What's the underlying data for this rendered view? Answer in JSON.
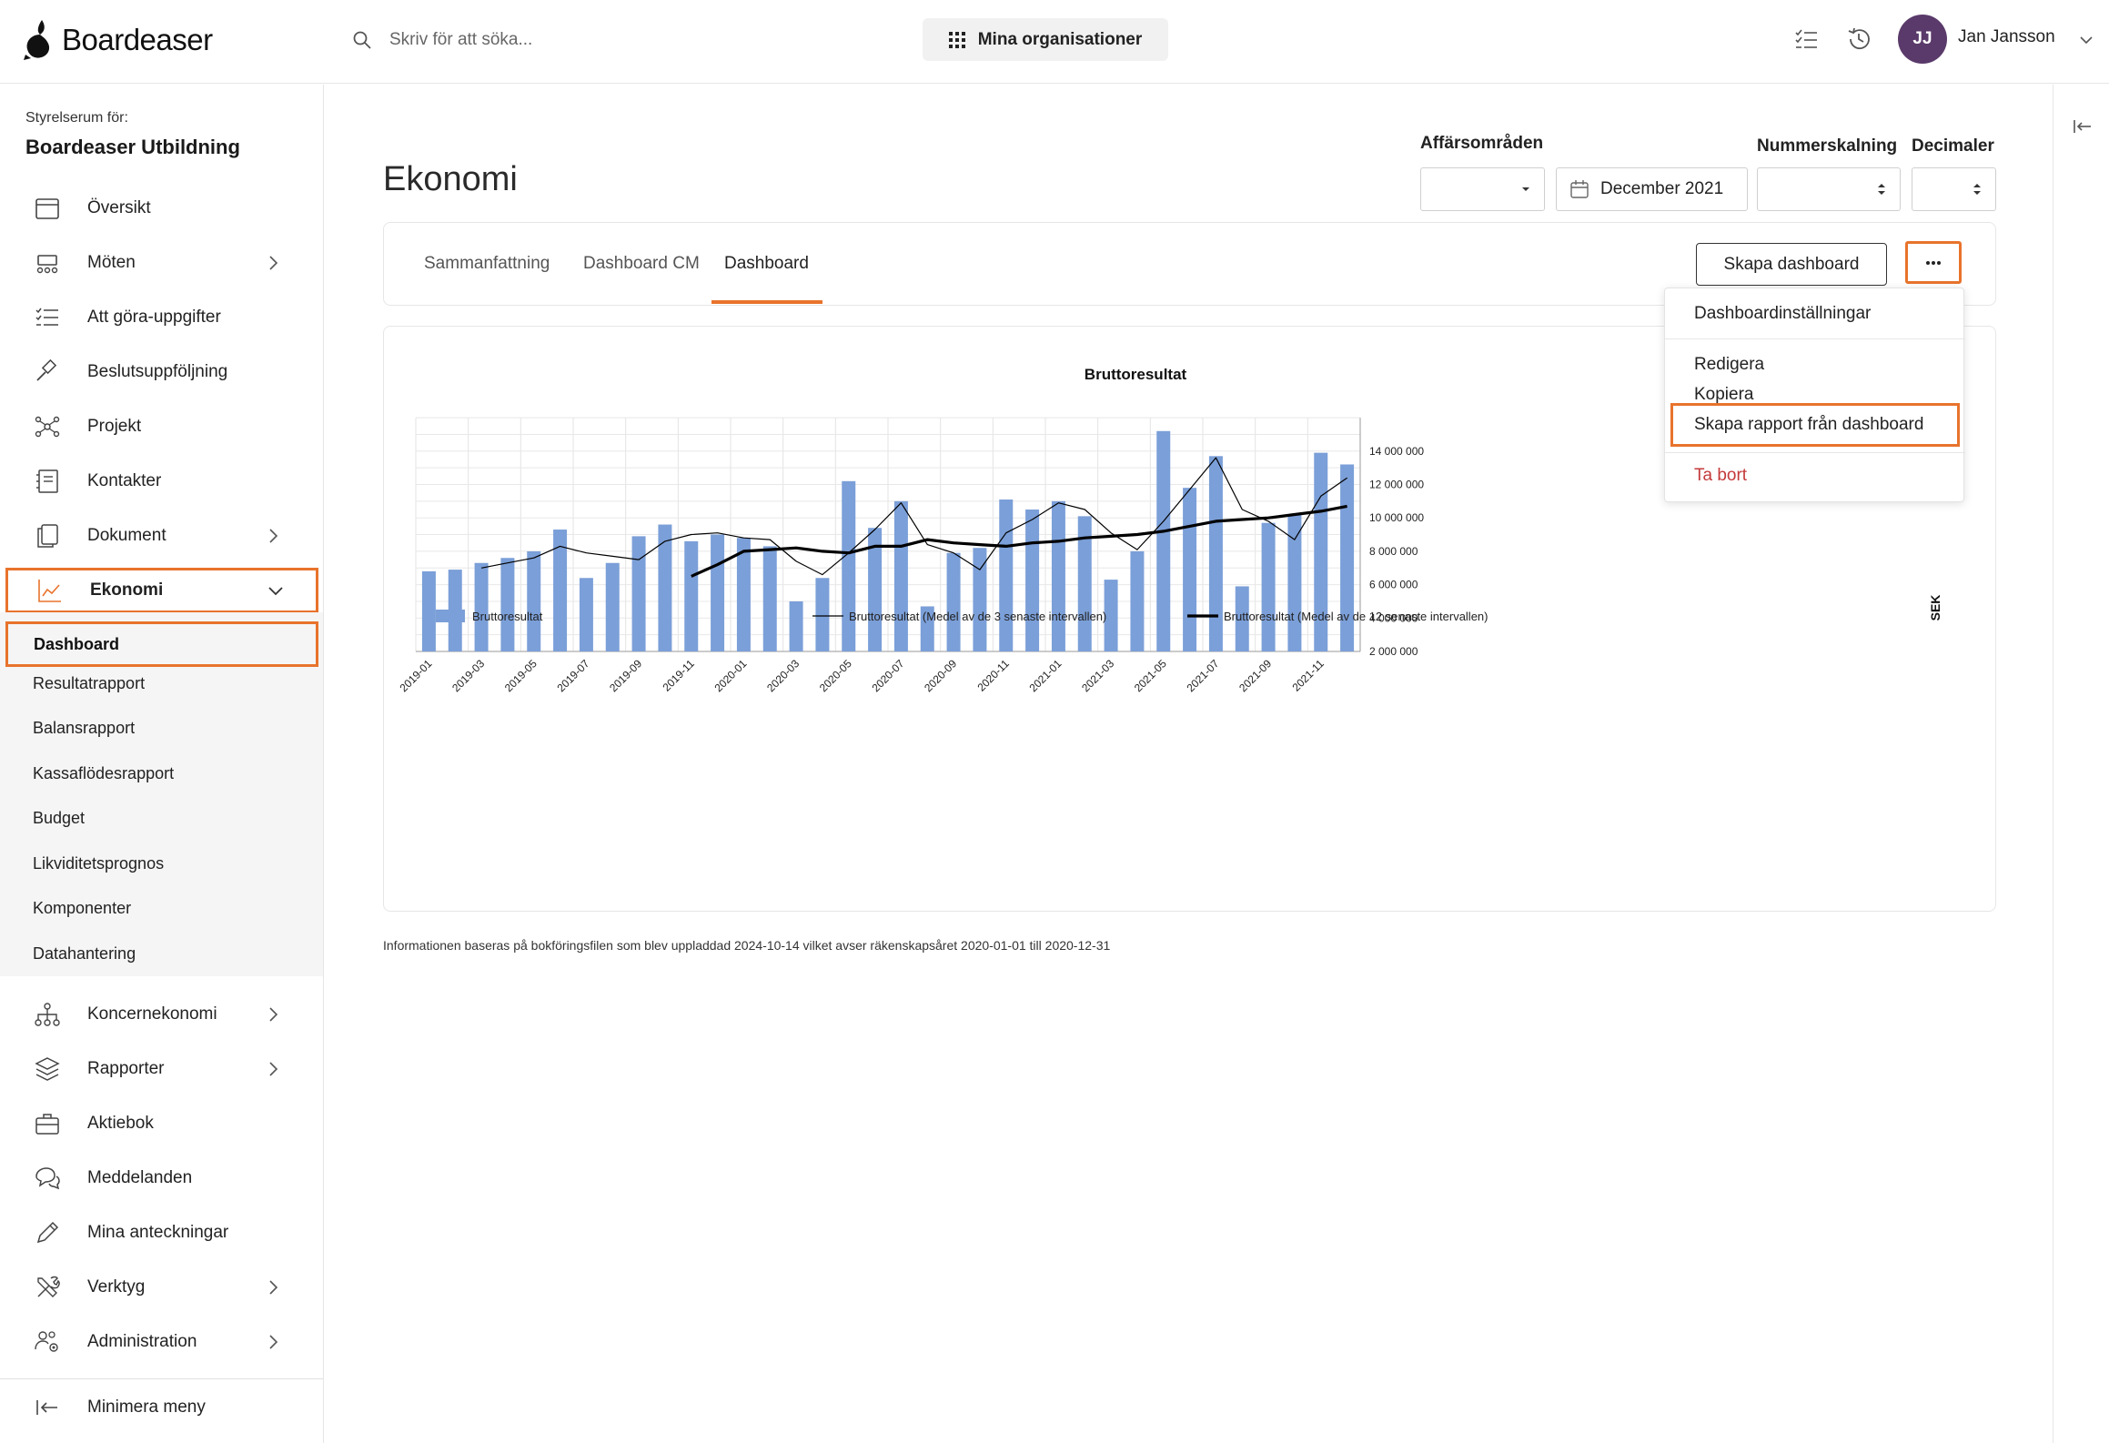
{
  "header": {
    "logo_text": "Boardeaser",
    "search_placeholder": "Skriv för att söka...",
    "org_button": "Mina organisationer",
    "avatar_initials": "JJ",
    "user_name": "Jan Jansson"
  },
  "sidebar": {
    "subtitle": "Styrelserum för:",
    "org_name": "Boardeaser Utbildning",
    "items": [
      {
        "label": "Översikt",
        "icon": "calendar-icon"
      },
      {
        "label": "Möten",
        "icon": "meeting-icon"
      },
      {
        "label": "Att göra-uppgifter",
        "icon": "checklist-icon"
      },
      {
        "label": "Beslutsuppföljning",
        "icon": "gavel-icon"
      },
      {
        "label": "Projekt",
        "icon": "network-icon"
      },
      {
        "label": "Kontakter",
        "icon": "contacts-icon"
      },
      {
        "label": "Dokument",
        "icon": "document-icon"
      },
      {
        "label": "Ekonomi",
        "icon": "chart-line-icon"
      }
    ],
    "sub_items": [
      "Dashboard",
      "Resultatrapport",
      "Balansrapport",
      "Kassaflödesrapport",
      "Budget",
      "Likviditetsprognos",
      "Komponenter",
      "Datahantering"
    ],
    "items_after": [
      {
        "label": "Koncernekonomi",
        "icon": "hierarchy-icon"
      },
      {
        "label": "Rapporter",
        "icon": "layers-icon"
      },
      {
        "label": "Aktiebok",
        "icon": "briefcase-icon"
      },
      {
        "label": "Meddelanden",
        "icon": "chat-icon"
      },
      {
        "label": "Mina anteckningar",
        "icon": "pencil-icon"
      },
      {
        "label": "Verktyg",
        "icon": "tools-icon"
      },
      {
        "label": "Administration",
        "icon": "users-gear-icon"
      }
    ],
    "minimize": "Minimera meny"
  },
  "main": {
    "title": "Ekonomi",
    "filters": {
      "affarsomraden_label": "Affärsområden",
      "affarsomraden_value": "",
      "period_value": "December 2021",
      "nummerskalning_label": "Nummerskalning",
      "nummerskalning_value": "",
      "decimaler_label": "Decimaler",
      "decimaler_value": ""
    },
    "tabs": [
      "Sammanfattning",
      "Dashboard CM",
      "Dashboard"
    ],
    "active_tab": "Dashboard",
    "create_button": "Skapa dashboard",
    "info_note": "Informationen baseras på bokföringsfilen som blev uppladdad 2024-10-14 vilket avser räkenskapsåret 2020-01-01 till 2020-12-31"
  },
  "menu": {
    "items": [
      "Dashboardinställningar",
      "Redigera",
      "Kopiera",
      "Skapa rapport från dashboard",
      "Ta bort"
    ],
    "highlighted": "Skapa rapport från dashboard"
  },
  "colors": {
    "accent": "#e8732c",
    "bar": "#7b9fd8",
    "danger": "#c43a3a",
    "avatar": "#5a3a6a"
  },
  "chart_data": {
    "type": "bar",
    "title": "Bruttoresultat",
    "ylabel": "SEK",
    "ylim": [
      2000000,
      16000000
    ],
    "y_ticks": [
      "2 000 000",
      "4 000 000",
      "6 000 000",
      "8 000 000",
      "10 000 000",
      "12 000 000",
      "14 000 000"
    ],
    "x_tick_labels": [
      "2019-01",
      "2019-03",
      "2019-05",
      "2019-07",
      "2019-09",
      "2019-11",
      "2020-01",
      "2020-03",
      "2020-05",
      "2020-07",
      "2020-09",
      "2020-11",
      "2021-01",
      "2021-03",
      "2021-05",
      "2021-07",
      "2021-09",
      "2021-11"
    ],
    "categories": [
      "2019-01",
      "2019-02",
      "2019-03",
      "2019-04",
      "2019-05",
      "2019-06",
      "2019-07",
      "2019-08",
      "2019-09",
      "2019-10",
      "2019-11",
      "2019-12",
      "2020-01",
      "2020-02",
      "2020-03",
      "2020-04",
      "2020-05",
      "2020-06",
      "2020-07",
      "2020-08",
      "2020-09",
      "2020-10",
      "2020-11",
      "2020-12",
      "2021-01",
      "2021-02",
      "2021-03",
      "2021-04",
      "2021-05",
      "2021-06",
      "2021-07",
      "2021-08",
      "2021-09",
      "2021-10",
      "2021-11",
      "2021-12"
    ],
    "series": [
      {
        "name": "Bruttoresultat",
        "kind": "bar",
        "values": [
          6800000,
          6900000,
          7300000,
          7600000,
          8000000,
          9300000,
          6400000,
          7300000,
          8900000,
          9600000,
          8600000,
          9000000,
          8800000,
          8300000,
          5000000,
          6400000,
          12200000,
          9400000,
          11000000,
          4700000,
          7900000,
          8200000,
          11100000,
          10500000,
          11000000,
          10100000,
          6300000,
          8000000,
          15200000,
          11800000,
          13700000,
          5900000,
          9700000,
          10200000,
          13900000,
          13200000
        ]
      },
      {
        "name": "Bruttoresultat (Medel av de 3 senaste intervallen)",
        "kind": "line",
        "values": [
          null,
          null,
          7000000,
          7300000,
          7600000,
          8300000,
          7900000,
          7700000,
          7500000,
          8600000,
          9000000,
          9100000,
          8800000,
          8700000,
          7400000,
          6600000,
          7900000,
          9300000,
          10900000,
          8400000,
          7900000,
          6900000,
          9100000,
          9900000,
          10900000,
          10500000,
          9100000,
          8100000,
          9800000,
          11700000,
          13600000,
          10500000,
          9800000,
          8700000,
          11300000,
          12400000
        ]
      },
      {
        "name": "Bruttoresultat (Medel av de 12 senaste intervallen)",
        "kind": "line",
        "values": [
          null,
          null,
          null,
          null,
          null,
          null,
          null,
          null,
          null,
          null,
          6500000,
          7200000,
          8000000,
          8100000,
          8200000,
          8000000,
          7900000,
          8300000,
          8300000,
          8700000,
          8500000,
          8400000,
          8300000,
          8500000,
          8600000,
          8800000,
          8900000,
          9000000,
          9200000,
          9500000,
          9800000,
          9900000,
          10000000,
          10200000,
          10400000,
          10700000
        ]
      }
    ],
    "legend_position": "bottom",
    "grid": true
  }
}
